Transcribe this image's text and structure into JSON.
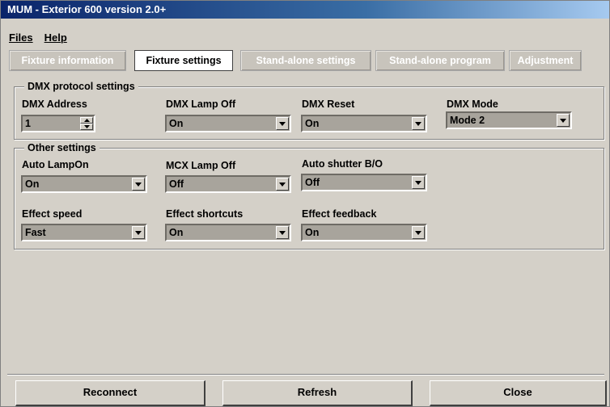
{
  "window": {
    "title": "MUM - Exterior 600 version 2.0+"
  },
  "menu": {
    "files": "Files",
    "help": "Help"
  },
  "tabs": [
    {
      "label": "Fixture information",
      "active": false
    },
    {
      "label": "Fixture settings",
      "active": true
    },
    {
      "label": "Stand-alone settings",
      "active": false
    },
    {
      "label": "Stand-alone program",
      "active": false
    },
    {
      "label": "Adjustment",
      "active": false
    }
  ],
  "dmx_group": {
    "legend": "DMX protocol settings",
    "address": {
      "label": "DMX Address",
      "value": "1"
    },
    "lamp_off": {
      "label": "DMX Lamp Off",
      "value": "On"
    },
    "reset": {
      "label": "DMX Reset",
      "value": "On"
    },
    "mode": {
      "label": "DMX Mode",
      "value": "Mode 2"
    }
  },
  "other_group": {
    "legend": "Other settings",
    "auto_lamp_on": {
      "label": "Auto LampOn",
      "value": "On"
    },
    "mcx_lamp_off": {
      "label": "MCX Lamp Off",
      "value": "Off"
    },
    "auto_shutter": {
      "label": "Auto shutter B/O",
      "value": "Off"
    },
    "effect_speed": {
      "label": "Effect speed",
      "value": "Fast"
    },
    "effect_shortcuts": {
      "label": "Effect shortcuts",
      "value": "On"
    },
    "effect_feedback": {
      "label": "Effect feedback",
      "value": "On"
    }
  },
  "buttons": {
    "reconnect": "Reconnect",
    "refresh": "Refresh",
    "close": "Close"
  }
}
